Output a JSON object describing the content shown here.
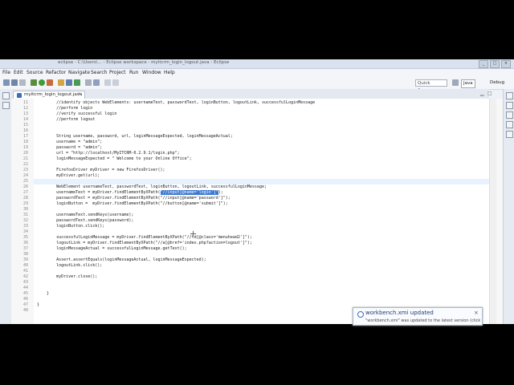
{
  "window": {
    "title": "eclipse - C:\\Users\\... - Eclipse workspace - myitcrm_login_logout.java - Eclipse"
  },
  "menu": [
    "File",
    "Edit",
    "Source",
    "Refactor",
    "Navigate",
    "Search",
    "Project",
    "Run",
    "Window",
    "Help"
  ],
  "toolbar": {
    "quick_access_placeholder": "Quick Access",
    "perspectives": [
      "Java",
      "Debug"
    ]
  },
  "editor": {
    "tab_label": "myitcrm_login_logout.java",
    "tab_close": "×",
    "highlighted_line": "25",
    "selected_text": "\"//input[@name='login']\"",
    "lines": [
      {
        "n": "11",
        "t": "        //identify objects WebElements: usernameText, passwordText, loginButton, logoutLink, successfulLoginMessage"
      },
      {
        "n": "12",
        "t": "        //perform login"
      },
      {
        "n": "13",
        "t": "        //verify successful login"
      },
      {
        "n": "14",
        "t": "        //perform logout"
      },
      {
        "n": "15",
        "t": ""
      },
      {
        "n": "16",
        "t": ""
      },
      {
        "n": "17",
        "t": "        String username, password, url, loginMessageExpected, loginMessageActual;"
      },
      {
        "n": "18",
        "t": "        username = \"admin\";"
      },
      {
        "n": "19",
        "t": "        password = \"admin\";"
      },
      {
        "n": "20",
        "t": "        url = \"http://localhost/MyITCRM-0.2.9.1/login.php\";"
      },
      {
        "n": "21",
        "t": "        loginMessageExpected = \" Welcome to your Online Office\";"
      },
      {
        "n": "22",
        "t": ""
      },
      {
        "n": "23",
        "t": "        FirefoxDriver myDriver = new FirefoxDriver();"
      },
      {
        "n": "24",
        "t": "        myDriver.get(url);"
      },
      {
        "n": "25",
        "t": ""
      },
      {
        "n": "26",
        "t": "        WebElement usernameText, passwordText, loginButton, logoutLink, successfulLoginMessage;"
      },
      {
        "n": "27",
        "t": "        usernameText = myDriver.findElementByXPath(\"//input[@name='login']\");"
      },
      {
        "n": "28",
        "t": "        passwordText = myDriver.findElementByXPath(\"//input[@name='password']\");"
      },
      {
        "n": "29",
        "t": "        loginButton =  myDriver.findElementByXPath(\"//button[@name='submit']\");"
      },
      {
        "n": "30",
        "t": ""
      },
      {
        "n": "31",
        "t": "        usernameText.sendKeys(username);"
      },
      {
        "n": "32",
        "t": "        passwordText.sendKeys(password);"
      },
      {
        "n": "33",
        "t": "        loginButton.click();"
      },
      {
        "n": "34",
        "t": ""
      },
      {
        "n": "35",
        "t": "        successfulLoginMessage = myDriver.findElementByXPath(\"//td[@class='menuhead2']\");"
      },
      {
        "n": "36",
        "t": "        logoutLink = myDriver.findElementByXPath(\"//a[@href='index.php?action=logout']\");"
      },
      {
        "n": "37",
        "t": "        loginMessageActual = successfulLoginMessage.getText();"
      },
      {
        "n": "38",
        "t": ""
      },
      {
        "n": "39",
        "t": "        Assert.assertEquals(loginMessageActual, loginMessageExpected);"
      },
      {
        "n": "40",
        "t": "        logoutLink.click();"
      },
      {
        "n": "41",
        "t": ""
      },
      {
        "n": "42",
        "t": "        myDriver.close();"
      },
      {
        "n": "43",
        "t": ""
      },
      {
        "n": "44",
        "t": ""
      },
      {
        "n": "45",
        "t": "    }"
      },
      {
        "n": "46",
        "t": ""
      },
      {
        "n": "47",
        "t": "}"
      },
      {
        "n": "48",
        "t": ""
      }
    ]
  },
  "notification": {
    "title": "workbench.xmi updated",
    "body": "\"workbench.xmi\" was updated to the latest version (click"
  },
  "colors": {
    "selection": "#3d79d1",
    "current_line": "#e8f2fe"
  }
}
